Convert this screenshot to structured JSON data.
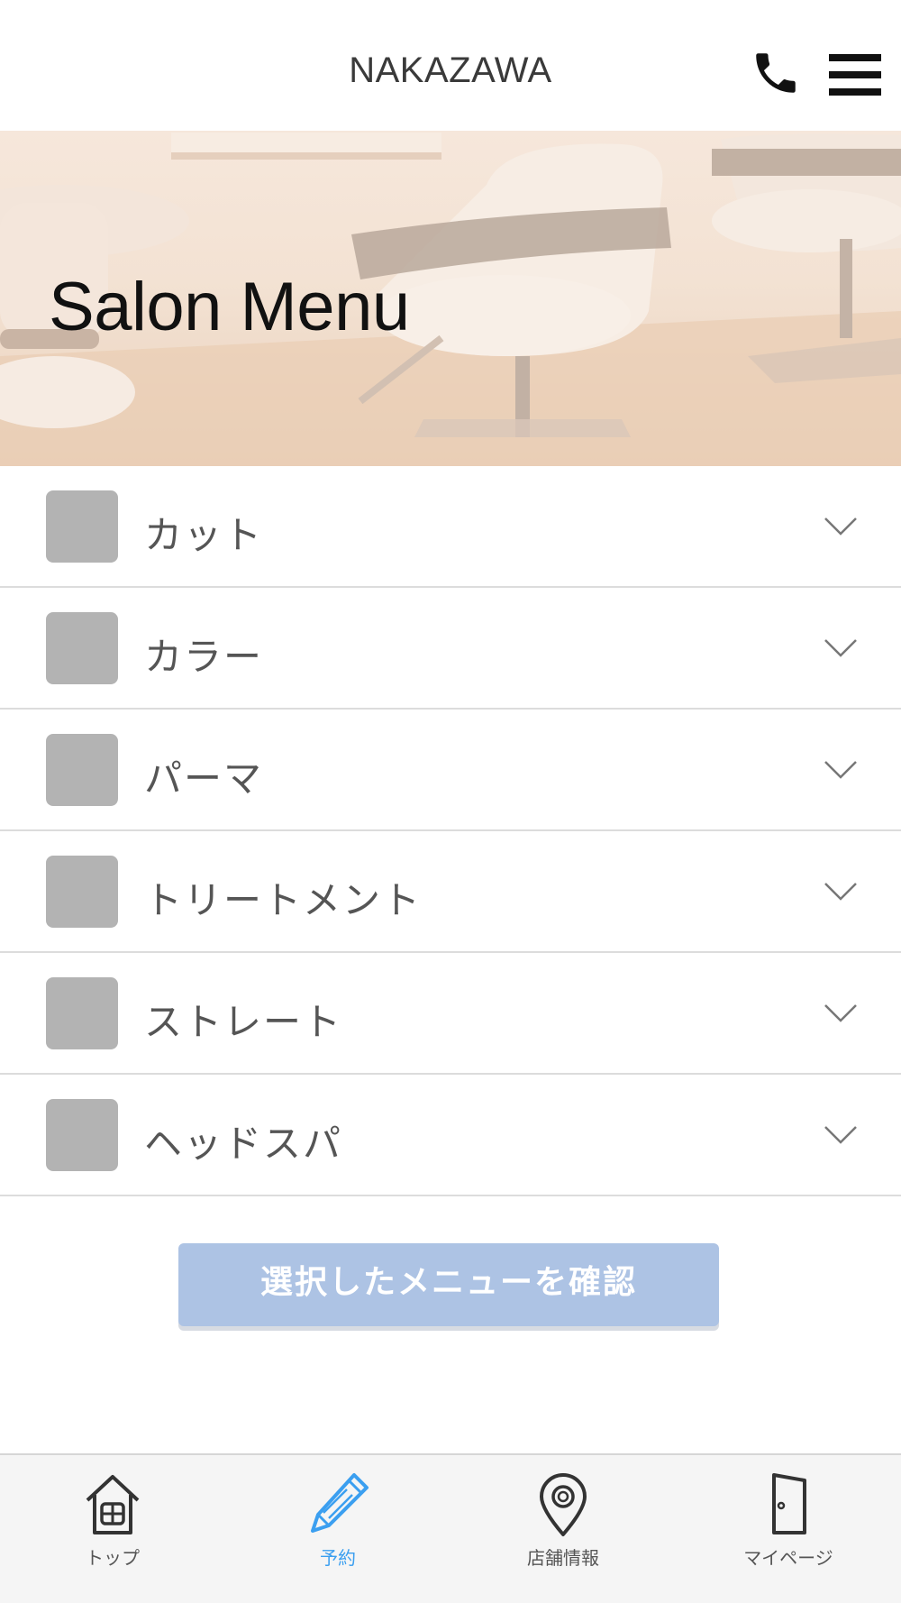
{
  "header": {
    "title": "NAKAZAWA"
  },
  "hero": {
    "title": "Salon Menu"
  },
  "menu": {
    "items": [
      {
        "label": "カット"
      },
      {
        "label": "カラー"
      },
      {
        "label": "パーマ"
      },
      {
        "label": "トリートメント"
      },
      {
        "label": "ストレート"
      },
      {
        "label": "ヘッドスパ"
      }
    ]
  },
  "confirm_button": {
    "label": "選択したメニューを確認"
  },
  "tabbar": {
    "tabs": [
      {
        "label": "トップ",
        "icon": "home-icon"
      },
      {
        "label": "予約",
        "icon": "pencil-icon",
        "active": true
      },
      {
        "label": "店舗情報",
        "icon": "location-pin-icon"
      },
      {
        "label": "マイページ",
        "icon": "door-icon"
      }
    ]
  },
  "colors": {
    "accent": "#3b9ff0",
    "button": "#adc3e4",
    "thumb": "#b3b3b3"
  }
}
